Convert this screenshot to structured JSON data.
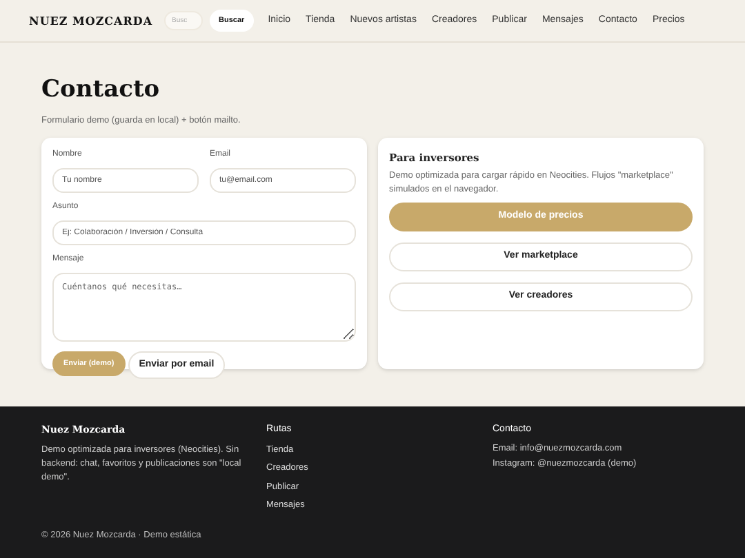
{
  "header": {
    "logo": "NUEZ MOZCARDA",
    "search": {
      "placeholder": "Busc"
    },
    "search_button": "Buscar",
    "nav": [
      "Inicio",
      "Tienda",
      "Nuevos artistas",
      "Creadores",
      "Publicar",
      "Mensajes",
      "Contacto",
      "Precios"
    ]
  },
  "page": {
    "title": "Contacto",
    "subtitle": "Formulario demo (guarda en local) + botón mailto."
  },
  "form": {
    "name": {
      "label": "Nombre",
      "placeholder": "Tu nombre"
    },
    "email": {
      "label": "Email",
      "placeholder": "tu@email.com"
    },
    "subject": {
      "label": "Asunto",
      "placeholder": "Ej: Colaboración / Inversión / Consulta"
    },
    "message": {
      "label": "Mensaje",
      "placeholder": "Cuéntanos qué necesitas…"
    },
    "buttons": [
      {
        "label": "Enviar (demo)",
        "kind": "primary"
      },
      {
        "label": "Enviar por email",
        "kind": "secondary"
      }
    ]
  },
  "investors": {
    "title": "Para inversores",
    "text": "Demo optimizada para cargar rápido en Neocities. Flujos \"marketplace\" simulados en el navegador.",
    "buttons": [
      {
        "label": "Modelo de precios",
        "kind": "primary"
      },
      {
        "label": "Ver marketplace",
        "kind": "secondary"
      },
      {
        "label": "Ver creadores",
        "kind": "secondary"
      }
    ]
  },
  "footer": {
    "brand": "Nuez Mozcarda",
    "about": "Demo optimizada para inversores (Neocities). Sin backend: chat, favoritos y publicaciones son \"local demo\".",
    "routes_title": "Rutas",
    "routes": [
      "Tienda",
      "Creadores",
      "Publicar",
      "Mensajes"
    ],
    "contact_title": "Contacto",
    "contact": [
      "Email: info@nuezmozcarda.com",
      "Instagram: @nuezmozcarda (demo)"
    ],
    "copyright": "© 2026 Nuez Mozcarda · Demo estática"
  }
}
